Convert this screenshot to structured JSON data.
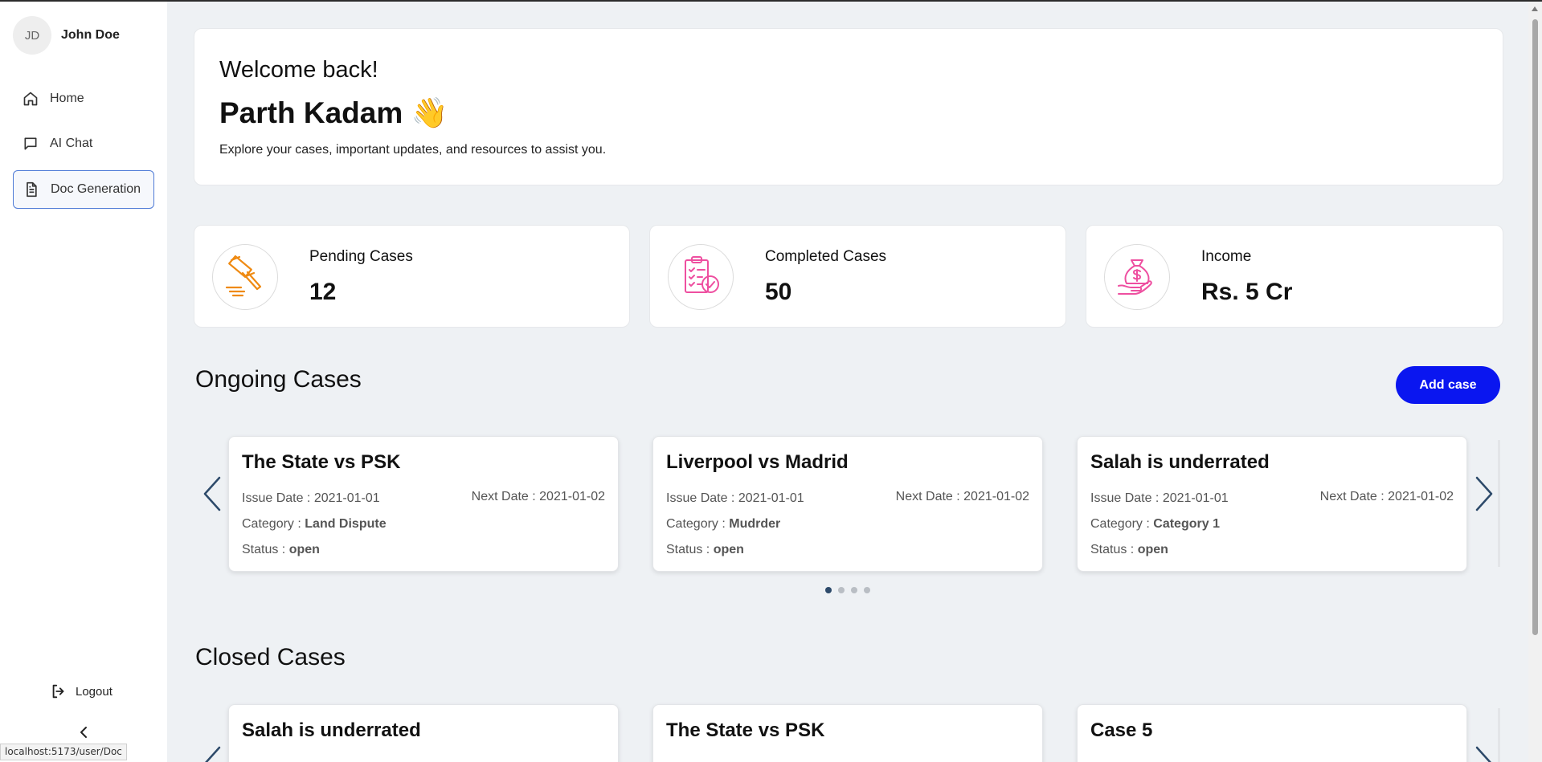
{
  "user": {
    "initials": "JD",
    "name": "John Doe"
  },
  "nav": [
    {
      "label": "Home",
      "icon": "home-icon"
    },
    {
      "label": "AI Chat",
      "icon": "chat-icon"
    },
    {
      "label": "Doc Generation",
      "icon": "document-icon",
      "active": true
    }
  ],
  "logout_label": "Logout",
  "status_url": "localhost:5173/user/Doc",
  "welcome": {
    "greeting": "Welcome back!",
    "name": "Parth Kadam 👋",
    "subtitle": "Explore your cases, important updates, and resources to assist you."
  },
  "stats": [
    {
      "label": "Pending Cases",
      "value": "12",
      "icon": "gavel-icon"
    },
    {
      "label": "Completed Cases",
      "value": "50",
      "icon": "checklist-icon"
    },
    {
      "label": "Income",
      "value": "Rs. 5 Cr",
      "icon": "money-bag-icon"
    }
  ],
  "ongoing": {
    "title": "Ongoing Cases",
    "add_label": "Add case",
    "cases": [
      {
        "title": "The State vs PSK",
        "issue": "Issue Date : 2021-01-01",
        "next": "Next Date : 2021-01-02",
        "category_label": "Category : ",
        "category": "Land Dispute",
        "status_label": "Status : ",
        "status": "open"
      },
      {
        "title": "Liverpool vs Madrid",
        "issue": "Issue Date : 2021-01-01",
        "next": "Next Date : 2021-01-02",
        "category_label": "Category : ",
        "category": "Mudrder",
        "status_label": "Status : ",
        "status": "open"
      },
      {
        "title": "Salah is underrated",
        "issue": "Issue Date : 2021-01-01",
        "next": "Next Date : 2021-01-02",
        "category_label": "Category : ",
        "category": "Category 1",
        "status_label": "Status : ",
        "status": "open"
      }
    ],
    "dots_total": 4,
    "dots_active": 1
  },
  "closed": {
    "title": "Closed Cases",
    "cases": [
      {
        "title": "Salah is underrated"
      },
      {
        "title": "The State vs PSK"
      },
      {
        "title": "Case 5"
      }
    ]
  },
  "colors": {
    "accent_button": "#0a16f0",
    "active_nav_border": "#4f7bd6",
    "gavel_icon": "#ef8a12",
    "pink_icon": "#ee4fa0",
    "arrow": "#2d4a6a"
  }
}
